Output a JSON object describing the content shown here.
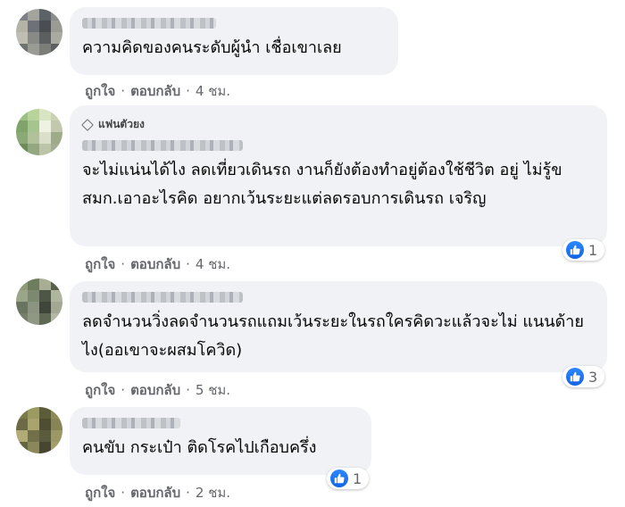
{
  "colors": {
    "bubble": "#f0f2f5",
    "meta": "#65676b",
    "like_blue": "#1877f2"
  },
  "comments": [
    {
      "text": "ความคิดของคนระดับผู้นำ เชื่อเขาเลย",
      "like_label": "ถูกใจ",
      "reply_label": "ตอบกลับ",
      "time": "4 ชม.",
      "reaction_count": null,
      "avatar_palette": [
        "#7d8087",
        "#a3a49c",
        "#5c6265",
        "#8b8f8c",
        "#b5b3a6",
        "#6e7278",
        "#4a4e52",
        "#9a9c93",
        "#c0beb3",
        "#878a86",
        "#5b5f60",
        "#a9aba1",
        "#6f736f",
        "#999b94",
        "#7b7e78",
        "#5d6061"
      ]
    },
    {
      "badge": "แฟนตัวยง",
      "badge_icon": "diamond-icon",
      "text": "จะไม่แน่นได้ไง ลดเที่ยวเดินรถ งานก็ยังต้องทำอยู่ต้องใช้ชีวิต อยู่ ไม่รู้ขสมก.เอาอะไรคิด อยากเว้นระยะแต่ลดรอบการเดินรถ เจริญ",
      "like_label": "ถูกใจ",
      "reply_label": "ตอบกลับ",
      "time": "4 ชม.",
      "reaction_count": "1",
      "avatar_palette": [
        "#9cbf85",
        "#b9d49b",
        "#d8e4c2",
        "#c9d2b1",
        "#7fa36a",
        "#a6c48e",
        "#eef2e0",
        "#c2c8ae",
        "#8aa977",
        "#b1c29a",
        "#d9dfc9",
        "#9eaa88",
        "#6e8c5a",
        "#95a781",
        "#bcc5a7",
        "#a5ad94"
      ]
    },
    {
      "text": "ลดจำนวนวิ่งลดจำนวนรถแถมเว้นระยะในรถใครคิดวะแล้วจะไม่ แนนด้ายไง(ออเขาจะผสมโควิด)",
      "like_label": "ถูกใจ",
      "reply_label": "ตอบกลับ",
      "time": "5 ชม.",
      "reaction_count": "3",
      "avatar_palette": [
        "#8d9a7c",
        "#6f7d5f",
        "#a7ae93",
        "#57604a",
        "#9aa58a",
        "#7c8870",
        "#4e5645",
        "#b0b59e",
        "#6a7560",
        "#8a9480",
        "#3f4539",
        "#a2a891",
        "#767f6b",
        "#909884",
        "#5f6853",
        "#b5b8a6"
      ]
    },
    {
      "text": "คนขับ กระเป๋า ติดโรคไปเกือบครึ่ง",
      "like_label": "ถูกใจ",
      "reply_label": "ตอบกลับ",
      "time": "2 ชม.",
      "reaction_count": "1",
      "avatar_palette": [
        "#7a7a4c",
        "#9b9a61",
        "#5d5c39",
        "#8e8b57",
        "#6b6a44",
        "#a9a36c",
        "#4f4e33",
        "#878555",
        "#b0ab77",
        "#72704a",
        "#5a5a3c",
        "#9c9865",
        "#66653f",
        "#8a8758",
        "#474631",
        "#a39f6b"
      ]
    }
  ]
}
